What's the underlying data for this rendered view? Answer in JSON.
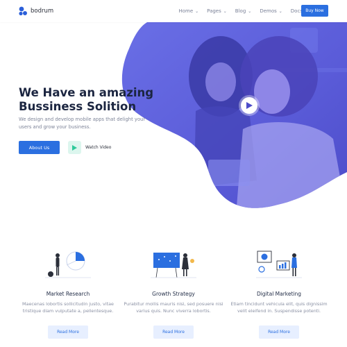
{
  "header": {
    "brand": "bodrum",
    "nav": [
      {
        "label": "Home"
      },
      {
        "label": "Pages"
      },
      {
        "label": "Blog"
      },
      {
        "label": "Demos"
      },
      {
        "label": "Docs"
      }
    ],
    "cta": "Buy Now"
  },
  "hero": {
    "title": "We Have an amazing Bussiness Solition",
    "description": "We design and develop mobile apps that delight your users and grow your business.",
    "primary_button": "About Us",
    "secondary_label": "Watch Video",
    "play_icon": "play-icon"
  },
  "features": [
    {
      "title": "Market Research",
      "description": "Maecenas lobortis sollicitudin justo, vitae tristique diam vulputate a, pellentesque.",
      "button": "Read More",
      "icon": "market-research-illustration"
    },
    {
      "title": "Growth Strategy",
      "description": "Purabitur mollis mauris nisi, sed posuere nisi varius quis. Nunc viverra lobortis.",
      "button": "Read More",
      "icon": "growth-strategy-illustration"
    },
    {
      "title": "Digital Marketing",
      "description": "Etiam tincidunt vehicula elit, quis dignissim velit eleifend in. Suspendisse potenti.",
      "button": "Read More",
      "icon": "digital-marketing-illustration"
    }
  ],
  "colors": {
    "accent": "#2b6fe0",
    "hero_blob": "#5b62e0",
    "play_green": "#2ec99a",
    "light_button": "#e7efff"
  }
}
